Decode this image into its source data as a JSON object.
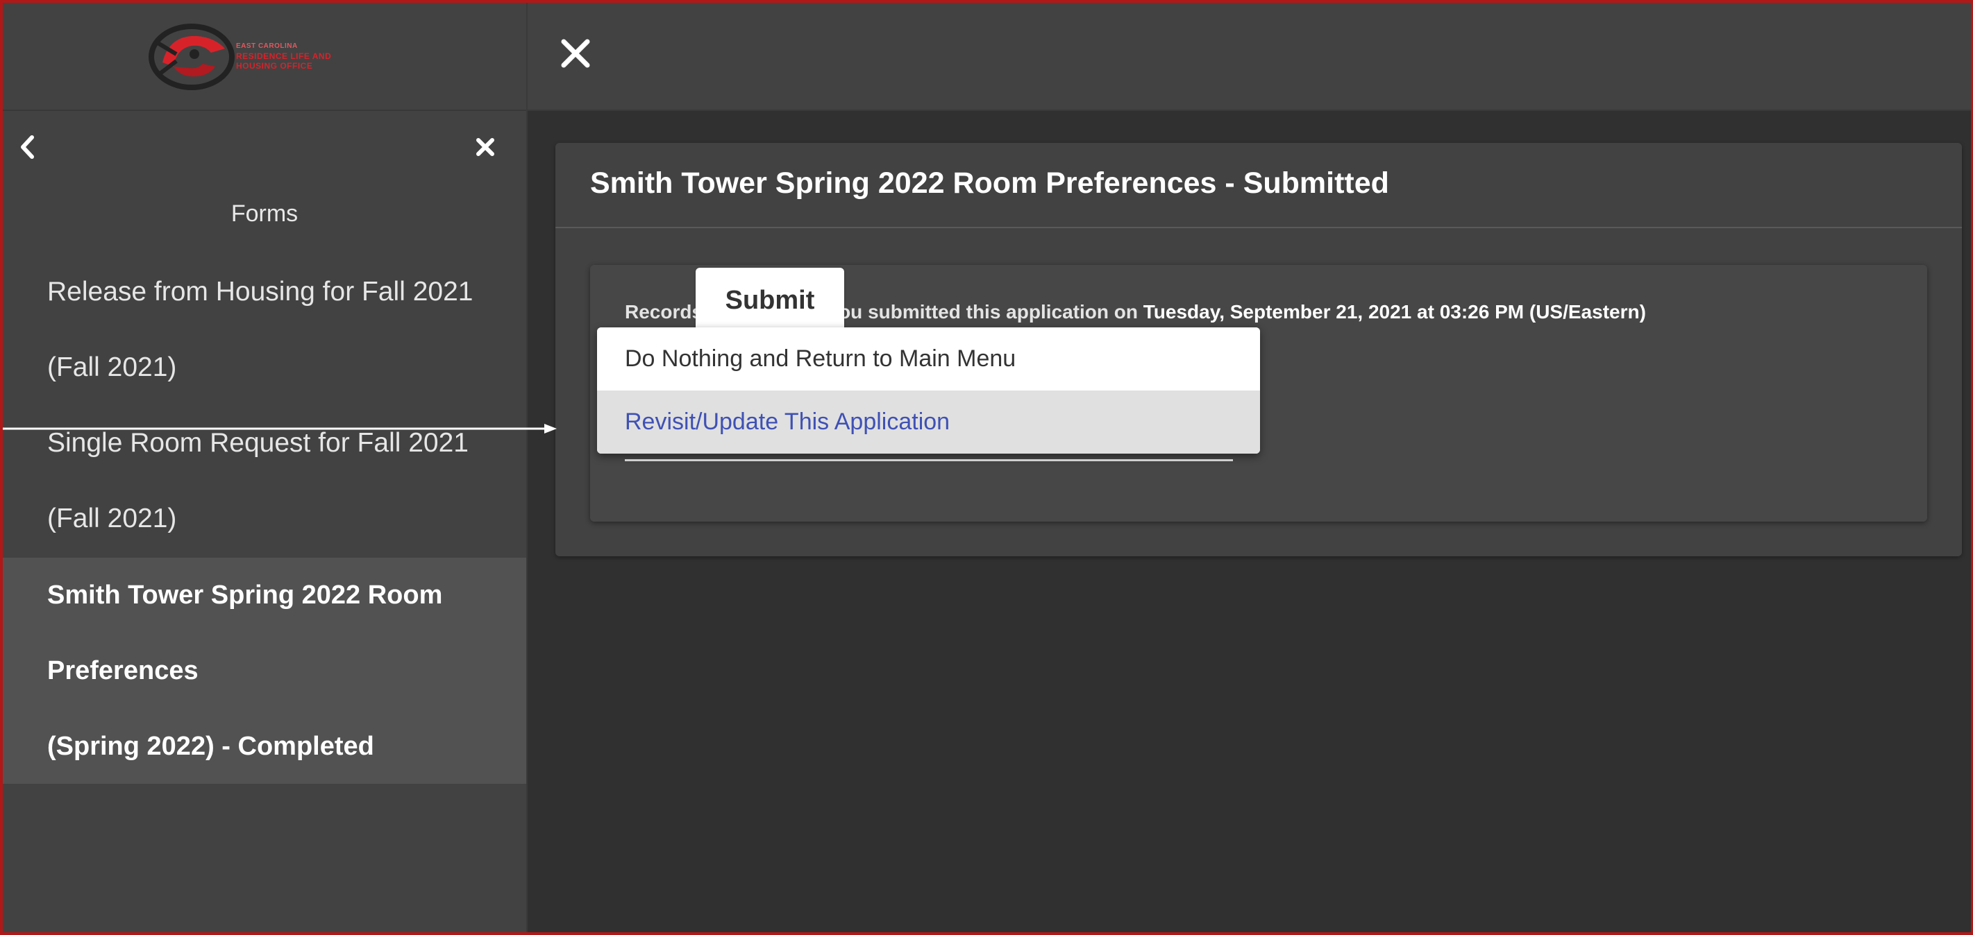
{
  "brand": {
    "logo_line_1": "EAST CAROLINA",
    "logo_line_2": "RESIDENCE LIFE AND",
    "logo_line_3": "HOUSING OFFICE",
    "accent_color": "#d8222a"
  },
  "sidebar": {
    "back_icon": "chevron-left-icon",
    "close_icon": "close-icon",
    "heading": "Forms",
    "items": [
      {
        "line1": "Release from Housing for Fall 2021",
        "line2": "(Fall 2021)"
      },
      {
        "line1": "Single Room Request for Fall 2021",
        "line2": "(Fall 2021)"
      },
      {
        "line1": "Smith Tower Spring 2022 Room",
        "line2": "Preferences",
        "line3": "(Spring 2022) - Completed"
      }
    ]
  },
  "topbar": {
    "close_icon": "close-icon"
  },
  "main": {
    "title": "Smith Tower Spring 2022 Room Preferences - Submitted",
    "records_prefix": "Records indicate that you submitted this application on ",
    "records_datetime": "Tuesday, September 21, 2021 at 03:26 PM (US/Eastern)",
    "submit_label": "Submit",
    "dropdown_options": [
      "Do Nothing and Return to Main Menu",
      "Revisit/Update This Application"
    ],
    "highlighted_option_color": "#3f51b5"
  }
}
